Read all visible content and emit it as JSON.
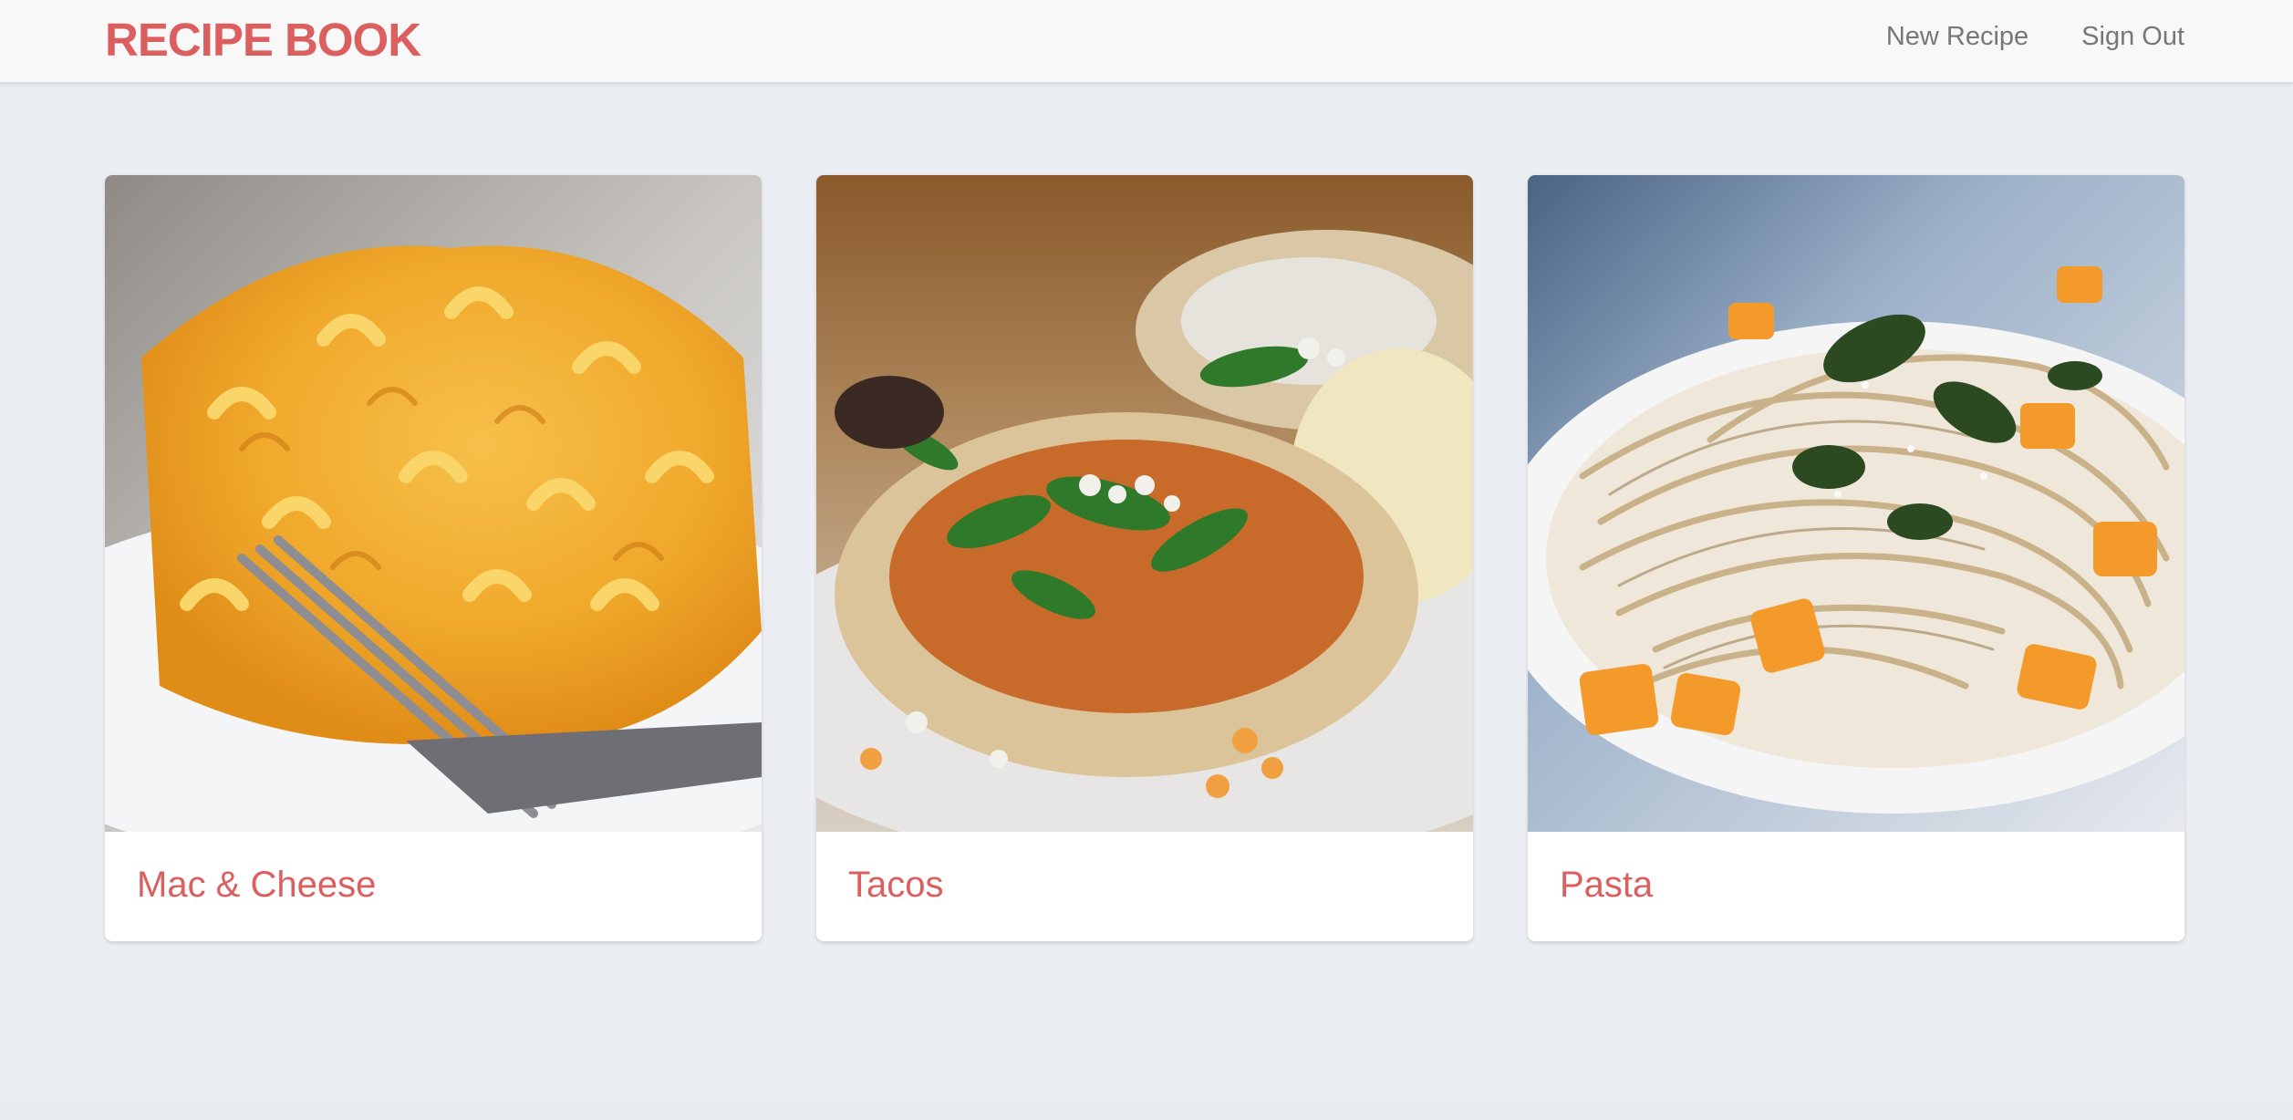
{
  "navbar": {
    "brand": "RECIPE BOOK",
    "links": [
      {
        "label": "New Recipe"
      },
      {
        "label": "Sign Out"
      }
    ]
  },
  "recipes": [
    {
      "title": "Mac & Cheese",
      "image": "mac-and-cheese-photo"
    },
    {
      "title": "Tacos",
      "image": "tacos-photo"
    },
    {
      "title": "Pasta",
      "image": "pasta-photo"
    }
  ],
  "colors": {
    "accent": "#db5f5f",
    "background": "#ebeef2",
    "navbar": "#f8f8f8",
    "nav_link": "#777777"
  }
}
